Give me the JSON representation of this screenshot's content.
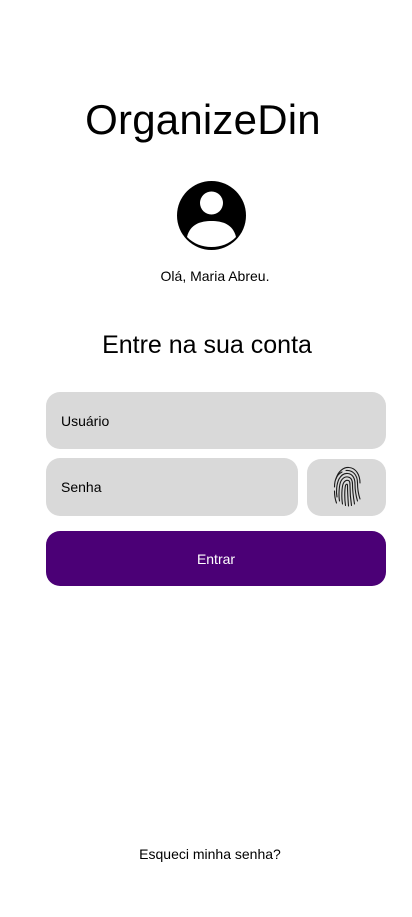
{
  "app": {
    "title": "OrganizeDin"
  },
  "profile": {
    "avatar_icon": "account-circle-icon",
    "greeting": "Olá, Maria Abreu."
  },
  "login": {
    "heading": "Entre na sua conta",
    "username_placeholder": "Usuário",
    "username_value": "",
    "password_placeholder": "Senha",
    "password_value": "",
    "fingerprint_icon": "fingerprint-icon",
    "submit_label": "Entrar",
    "forgot_password_label": "Esqueci minha senha?"
  },
  "colors": {
    "accent": "#4b0076",
    "field_background": "#d9d9d9",
    "background": "#ffffff"
  }
}
